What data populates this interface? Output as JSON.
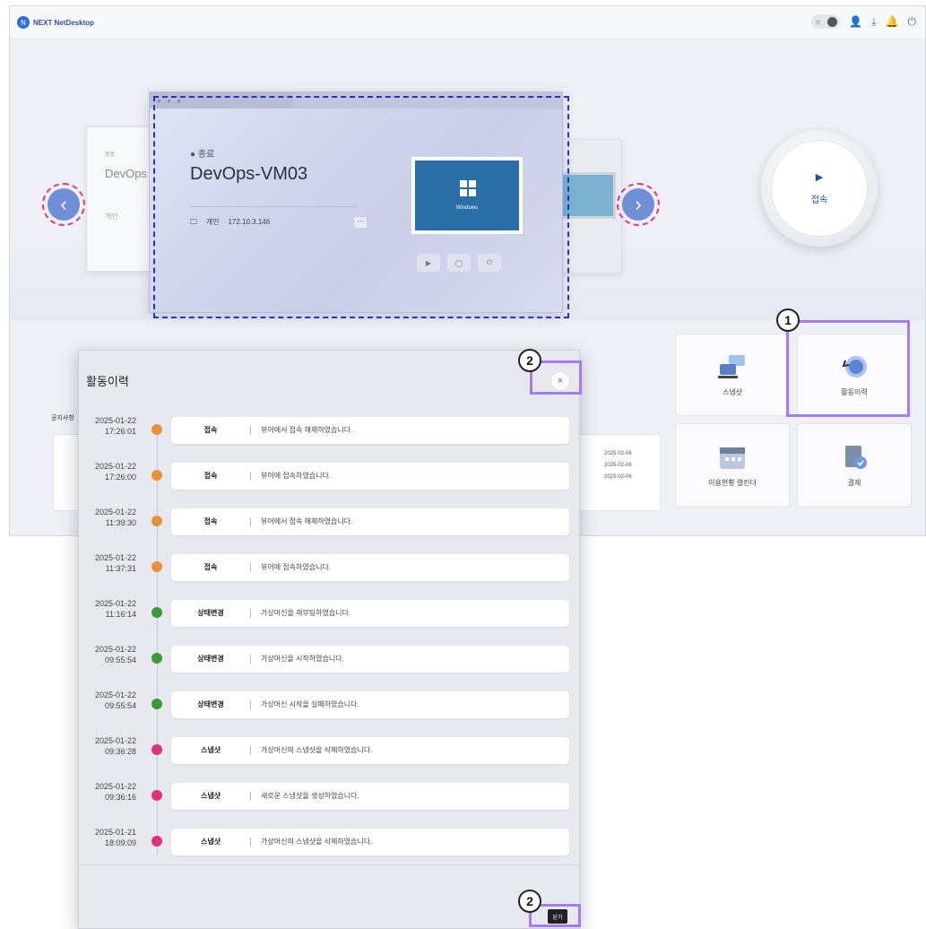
{
  "header": {
    "logo_text": "NEXT NetDesktop",
    "icons": [
      "sun-icon",
      "user-icon",
      "download-icon",
      "bell-icon",
      "logout-icon"
    ]
  },
  "carousel": {
    "prev_vm": {
      "status": "종료",
      "name": "DevOps",
      "ip_prefix": "개인"
    },
    "current_vm": {
      "status": "종료",
      "name": "DevOps-VM03",
      "type_label": "개인",
      "ip": "172.10.3.146",
      "more_label": "···",
      "os_label": "Windows"
    }
  },
  "connect": {
    "label": "접속"
  },
  "quick_menu": {
    "snapshot": "스냅샷",
    "activity": "활동이력",
    "usage_calendar": "이용현황 캘린더",
    "approval": "결재"
  },
  "notice": {
    "label": "공지사항",
    "dates": [
      "2025-02-06",
      "2025-02-06",
      "2025-02-06"
    ]
  },
  "annotations": {
    "badge1": "1",
    "badge2": "2"
  },
  "modal": {
    "title": "활동이력",
    "close_icon": "×",
    "close_button": "닫기",
    "entries": [
      {
        "date": "2025-01-22",
        "time": "17:26:01",
        "cat": "접속",
        "msg": "뷰어에서 접속 해제하였습니다.",
        "color": "#e8913a"
      },
      {
        "date": "2025-01-22",
        "time": "17:26:00",
        "cat": "접속",
        "msg": "뷰어에 접속하였습니다.",
        "color": "#e8913a"
      },
      {
        "date": "2025-01-22",
        "time": "11:39:30",
        "cat": "접속",
        "msg": "뷰어에서 접속 해제하였습니다.",
        "color": "#e8913a"
      },
      {
        "date": "2025-01-22",
        "time": "11:37:31",
        "cat": "접속",
        "msg": "뷰어에 접속하였습니다.",
        "color": "#e8913a"
      },
      {
        "date": "2025-01-22",
        "time": "11:16:14",
        "cat": "상태변경",
        "msg": "가상머신을 재부팅하였습니다.",
        "color": "#3a9b3a"
      },
      {
        "date": "2025-01-22",
        "time": "09:55:54",
        "cat": "상태변경",
        "msg": "가상머신을 시작하였습니다.",
        "color": "#3a9b3a"
      },
      {
        "date": "2025-01-22",
        "time": "09:55:54",
        "cat": "상태변경",
        "msg": "가상머신 시작을 실패하였습니다.",
        "color": "#3a9b3a"
      },
      {
        "date": "2025-01-22",
        "time": "09:36:28",
        "cat": "스냅샷",
        "msg": "가상머신의 스냅샷을 삭제하였습니다.",
        "color": "#e0307a"
      },
      {
        "date": "2025-01-22",
        "time": "09:36:16",
        "cat": "스냅샷",
        "msg": "새로운 스냅샷을 생성하였습니다.",
        "color": "#e0307a"
      },
      {
        "date": "2025-01-21",
        "time": "18:09:09",
        "cat": "스냅샷",
        "msg": "가상머신의 스냅샷을 삭제하였습니다.",
        "color": "#e0307a"
      }
    ]
  }
}
